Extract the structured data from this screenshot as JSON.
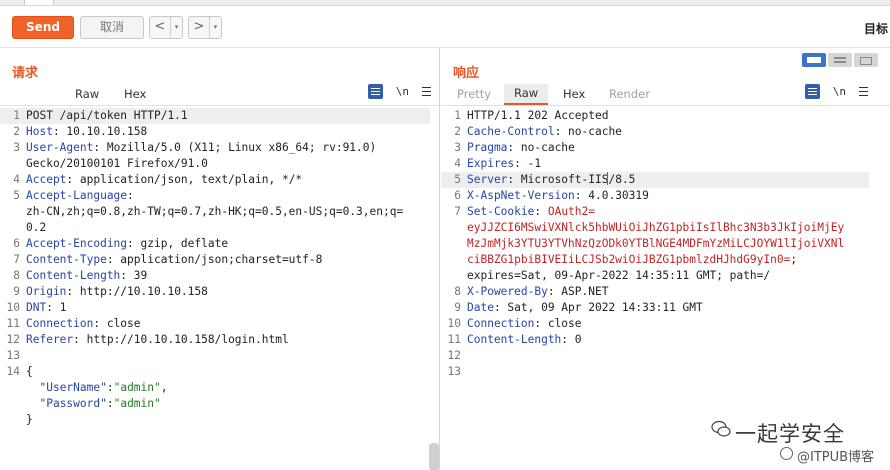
{
  "toolbar": {
    "send_label": "Send",
    "cancel_label": "取消",
    "prev_label": "<",
    "next_label": ">",
    "dropdown_glyph": "▾",
    "target_label": "目标"
  },
  "request": {
    "title": "请求",
    "tabs": [
      "Raw",
      "Hex"
    ],
    "active_tab": "Raw",
    "newline_toggle": "\\n",
    "lines": [
      {
        "n": "1",
        "parts": [
          [
            "v",
            "POST /api/token HTTP/1.1"
          ]
        ],
        "highlight": true
      },
      {
        "n": "2",
        "parts": [
          [
            "k",
            "Host"
          ],
          [
            "v",
            ": 10.10.10.158"
          ]
        ]
      },
      {
        "n": "3",
        "parts": [
          [
            "k",
            "User-Agent"
          ],
          [
            "v",
            ": Mozilla/5.0 (X11; Linux x86_64; rv:91.0)"
          ]
        ]
      },
      {
        "n": "",
        "parts": [
          [
            "v",
            "Gecko/20100101 Firefox/91.0"
          ]
        ]
      },
      {
        "n": "4",
        "parts": [
          [
            "k",
            "Accept"
          ],
          [
            "v",
            ": application/json, text/plain, */*"
          ]
        ]
      },
      {
        "n": "5",
        "parts": [
          [
            "k",
            "Accept-Language"
          ],
          [
            "v",
            ":"
          ]
        ]
      },
      {
        "n": "",
        "parts": [
          [
            "v",
            "zh-CN,zh;q=0.8,zh-TW;q=0.7,zh-HK;q=0.5,en-US;q=0.3,en;q="
          ]
        ]
      },
      {
        "n": "",
        "parts": [
          [
            "v",
            "0.2"
          ]
        ]
      },
      {
        "n": "6",
        "parts": [
          [
            "k",
            "Accept-Encoding"
          ],
          [
            "v",
            ": gzip, deflate"
          ]
        ]
      },
      {
        "n": "7",
        "parts": [
          [
            "k",
            "Content-Type"
          ],
          [
            "v",
            ": application/json;charset=utf-8"
          ]
        ]
      },
      {
        "n": "8",
        "parts": [
          [
            "k",
            "Content-Length"
          ],
          [
            "v",
            ": 39"
          ]
        ]
      },
      {
        "n": "9",
        "parts": [
          [
            "k",
            "Origin"
          ],
          [
            "v",
            ": http://10.10.10.158"
          ]
        ]
      },
      {
        "n": "10",
        "parts": [
          [
            "k",
            "DNT"
          ],
          [
            "v",
            ": 1"
          ]
        ]
      },
      {
        "n": "11",
        "parts": [
          [
            "k",
            "Connection"
          ],
          [
            "v",
            ": close"
          ]
        ]
      },
      {
        "n": "12",
        "parts": [
          [
            "k",
            "Referer"
          ],
          [
            "v",
            ": http://10.10.10.158/login.html"
          ]
        ]
      },
      {
        "n": "13",
        "parts": []
      },
      {
        "n": "14",
        "parts": [
          [
            "v",
            "{"
          ]
        ]
      },
      {
        "n": "",
        "parts": [
          [
            "v",
            "  "
          ],
          [
            "k",
            "\"UserName\""
          ],
          [
            "v",
            ":"
          ],
          [
            "s",
            "\"admin\""
          ],
          [
            "v",
            ","
          ]
        ]
      },
      {
        "n": "",
        "parts": [
          [
            "v",
            "  "
          ],
          [
            "k",
            "\"Password\""
          ],
          [
            "v",
            ":"
          ],
          [
            "s",
            "\"admin\""
          ]
        ]
      },
      {
        "n": "",
        "parts": [
          [
            "v",
            "}"
          ]
        ]
      }
    ]
  },
  "response": {
    "title": "响应",
    "tabs": [
      "Pretty",
      "Raw",
      "Hex",
      "Render"
    ],
    "active_tab": "Raw",
    "newline_toggle": "\\n",
    "lines": [
      {
        "n": "1",
        "parts": [
          [
            "v",
            "HTTP/1.1 202 Accepted"
          ]
        ]
      },
      {
        "n": "2",
        "parts": [
          [
            "k",
            "Cache-Control"
          ],
          [
            "v",
            ": no-cache"
          ]
        ]
      },
      {
        "n": "3",
        "parts": [
          [
            "k",
            "Pragma"
          ],
          [
            "v",
            ": no-cache"
          ]
        ]
      },
      {
        "n": "4",
        "parts": [
          [
            "k",
            "Expires"
          ],
          [
            "v",
            ": -1"
          ]
        ]
      },
      {
        "n": "5",
        "parts": [
          [
            "k",
            "Server"
          ],
          [
            "v",
            ": Microsoft-IIS"
          ],
          [
            "cursor",
            ""
          ],
          [
            "v",
            "/8.5"
          ]
        ],
        "highlight": true
      },
      {
        "n": "6",
        "parts": [
          [
            "k",
            "X-AspNet-Version"
          ],
          [
            "v",
            ": 4.0.30319"
          ]
        ]
      },
      {
        "n": "7",
        "parts": [
          [
            "k",
            "Set-Cookie"
          ],
          [
            "v",
            ": "
          ],
          [
            "r",
            "OAuth2="
          ]
        ]
      },
      {
        "n": "",
        "parts": [
          [
            "r",
            "eyJJZCI6MSwiVXNlck5hbWUiOiJhZG1pbiIsIlBhc3N3b3JkIjoiMjEy"
          ]
        ]
      },
      {
        "n": "",
        "parts": [
          [
            "r",
            "MzJmMjk3YTU3YTVhNzQzODk0YTBlNGE4MDFmYzMiLCJOYW1lIjoiVXNl"
          ]
        ]
      },
      {
        "n": "",
        "parts": [
          [
            "r",
            "ciBBZG1pbiBIVEIiLCJSb2wiOiJBZG1pbmlzdHJhdG9yIn0="
          ],
          [
            "v",
            ";"
          ]
        ]
      },
      {
        "n": "",
        "parts": [
          [
            "v",
            "expires=Sat, 09-Apr-2022 14:35:11 GMT; path=/"
          ]
        ]
      },
      {
        "n": "8",
        "parts": [
          [
            "k",
            "X-Powered-By"
          ],
          [
            "v",
            ": ASP.NET"
          ]
        ]
      },
      {
        "n": "9",
        "parts": [
          [
            "k",
            "Date"
          ],
          [
            "v",
            ": Sat, 09 Apr 2022 14:33:11 GMT"
          ]
        ]
      },
      {
        "n": "10",
        "parts": [
          [
            "k",
            "Connection"
          ],
          [
            "v",
            ": close"
          ]
        ]
      },
      {
        "n": "11",
        "parts": [
          [
            "k",
            "Content-Length"
          ],
          [
            "v",
            ": 0"
          ]
        ]
      },
      {
        "n": "12",
        "parts": []
      },
      {
        "n": "13",
        "parts": []
      }
    ]
  },
  "watermark": {
    "brand_text": "一起学安全",
    "source_text": "@ITPUB博客"
  }
}
